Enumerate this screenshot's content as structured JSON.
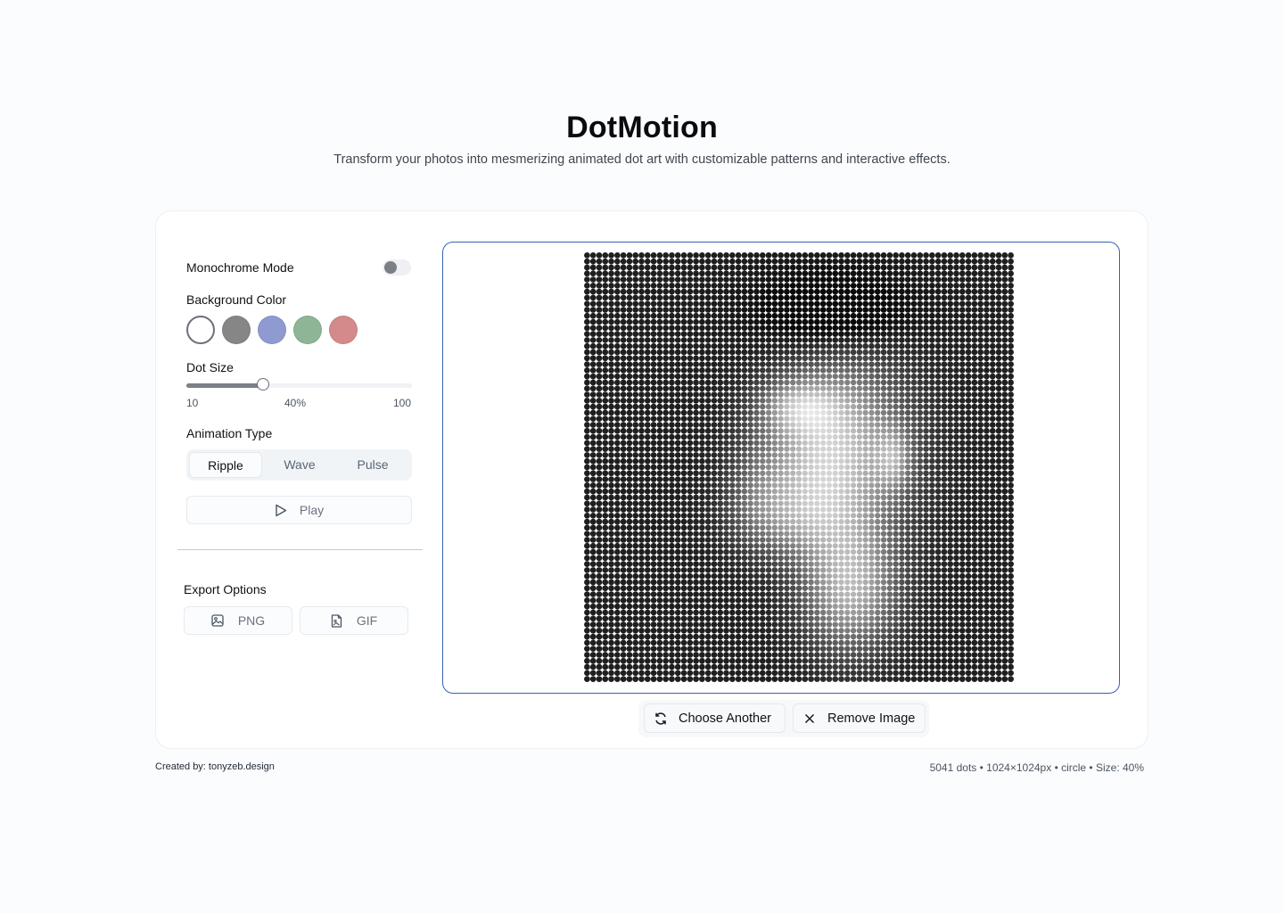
{
  "header": {
    "title": "DotMotion",
    "subtitle": "Transform your photos into mesmerizing animated dot art with customizable patterns and interactive effects."
  },
  "controls": {
    "monochrome_label": "Monochrome Mode",
    "monochrome_on": false,
    "background_label": "Background Color",
    "background_colors": [
      "#ffffff",
      "#868686",
      "#8f9bd0",
      "#8db596",
      "#d48a8a"
    ],
    "background_selected": 0,
    "dot_size_label": "Dot Size",
    "dot_size_min": "10",
    "dot_size_value": "40%",
    "dot_size_max": "100",
    "dot_size_fraction": 0.34,
    "animation_label": "Animation Type",
    "animation_options": [
      "Ripple",
      "Wave",
      "Pulse"
    ],
    "animation_selected": "Ripple",
    "play_label": "Play"
  },
  "export": {
    "label": "Export Options",
    "png_label": "PNG",
    "gif_label": "GIF"
  },
  "actions": {
    "choose_label": "Choose Another",
    "remove_label": "Remove Image"
  },
  "footer": {
    "credit": "Created by: tonyzeb.design",
    "stats": "5041 dots • 1024×1024px • circle • Size: 40%"
  }
}
